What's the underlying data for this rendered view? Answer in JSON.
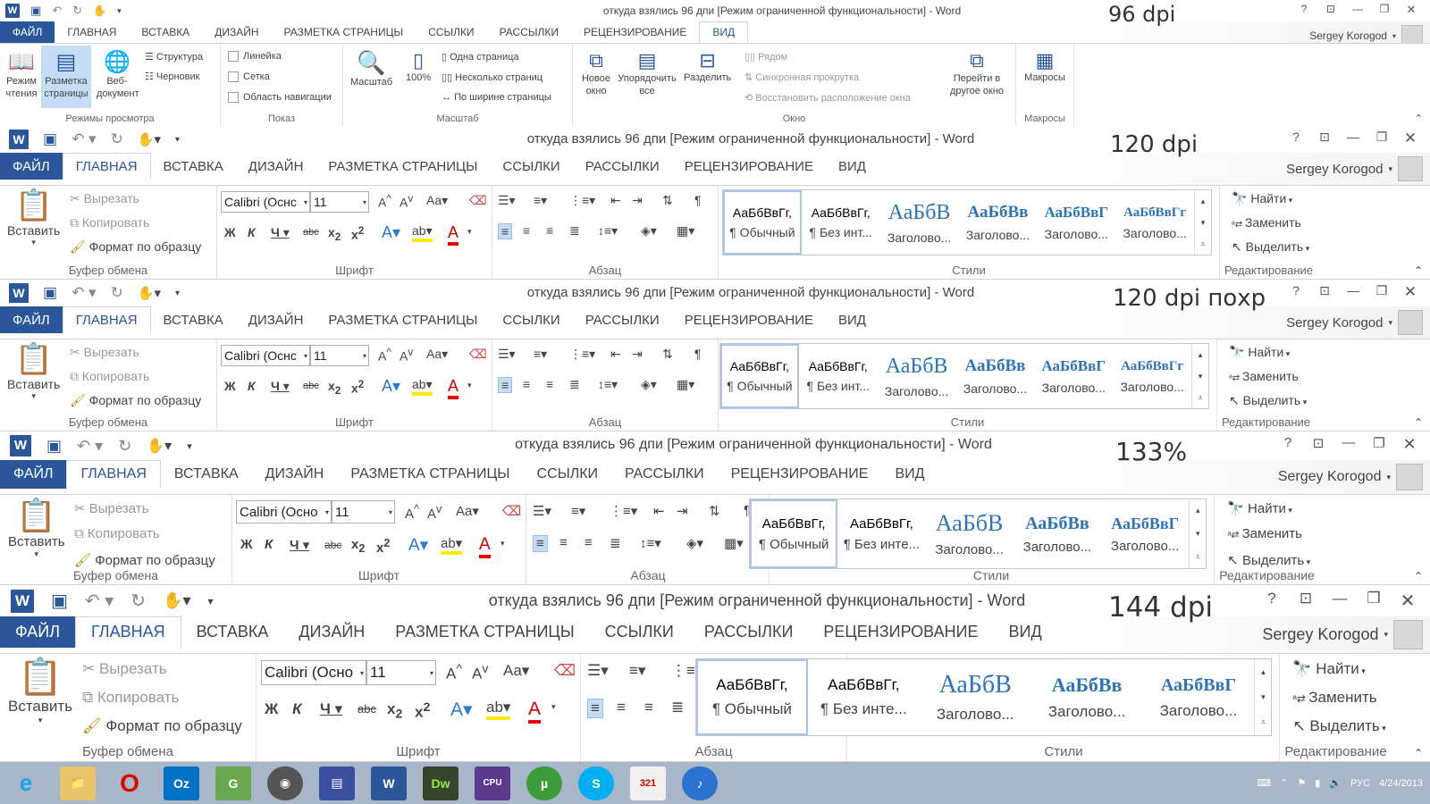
{
  "bands": [
    {
      "dpi": "96 dpi",
      "title": "откуда взялись 96 дпи [Режим ограниченной функциональности] - Word",
      "tabs": [
        "ФАЙЛ",
        "ГЛАВНАЯ",
        "ВСТАВКА",
        "ДИЗАЙН",
        "РАЗМЕТКА СТРАНИЦЫ",
        "ССЫЛКИ",
        "РАССЫЛКИ",
        "РЕЦЕНЗИРОВАНИЕ",
        "ВИД"
      ],
      "active_tab": "ВИД",
      "user": "Sergey Korogod",
      "view_ribbon": {
        "modes": {
          "read": "Режим чтения",
          "print": "Разметка страницы",
          "web": "Веб-документ",
          "outline": "Структура",
          "draft": "Черновик",
          "label": "Режимы просмотра"
        },
        "show": {
          "ruler": "Линейка",
          "grid": "Сетка",
          "nav": "Область навигации",
          "label": "Показ"
        },
        "zoom": {
          "zoom": "Масштаб",
          "pct": "100%",
          "one": "Одна страница",
          "multi": "Несколько страниц",
          "width": "По ширине страницы",
          "label": "Масштаб"
        },
        "window": {
          "new": "Новое окно",
          "arrange": "Упорядочить все",
          "split": "Разделить",
          "side": "Рядом",
          "sync": "Синхронная прокрутка",
          "reset": "Восстановить расположение окна",
          "switch": "Перейти в другое окно",
          "label": "Окно"
        },
        "macros": {
          "btn": "Макросы",
          "label": "Макросы"
        }
      }
    },
    {
      "dpi": "120 dpi",
      "title": "откуда взялись 96 дпи [Режим ограниченной функциональности] - Word",
      "tabs": [
        "ФАЙЛ",
        "ГЛАВНАЯ",
        "ВСТАВКА",
        "ДИЗАЙН",
        "РАЗМЕТКА СТРАНИЦЫ",
        "ССЫЛКИ",
        "РАССЫЛКИ",
        "РЕЦЕНЗИРОВАНИЕ",
        "ВИД"
      ],
      "user": "Sergey Korogod"
    },
    {
      "dpi": "120 dpi похр",
      "title": "откуда взялись 96 дпи [Режим ограниченной функциональности] - Word",
      "tabs": [
        "ФАЙЛ",
        "ГЛАВНАЯ",
        "ВСТАВКА",
        "ДИЗАЙН",
        "РАЗМЕТКА СТРАНИЦЫ",
        "ССЫЛКИ",
        "РАССЫЛКИ",
        "РЕЦЕНЗИРОВАНИЕ",
        "ВИД"
      ],
      "user": "Sergey Korogod"
    },
    {
      "dpi": "133%",
      "title": "откуда взялись 96 дпи [Режим ограниченной функциональности] - Word",
      "tabs": [
        "ФАЙЛ",
        "ГЛАВНАЯ",
        "ВСТАВКА",
        "ДИЗАЙН",
        "РАЗМЕТКА СТРАНИЦЫ",
        "ССЫЛКИ",
        "РАССЫЛКИ",
        "РЕЦЕНЗИРОВАНИЕ",
        "ВИД"
      ],
      "user": "Sergey Korogod"
    },
    {
      "dpi": "144 dpi",
      "title": "откуда взялись 96 дпи [Режим ограниченной функциональности] - Word",
      "tabs": [
        "ФАЙЛ",
        "ГЛАВНАЯ",
        "ВСТАВКА",
        "ДИЗАЙН",
        "РАЗМЕТКА СТРАНИЦЫ",
        "ССЫЛКИ",
        "РАССЫЛКИ",
        "РЕЦЕНЗИРОВАНИЕ",
        "ВИД"
      ],
      "user": "Sergey Korogod"
    }
  ],
  "home": {
    "paste": "Вставить",
    "cut": "Вырезать",
    "copy": "Копировать",
    "painter": "Формат по образцу",
    "clipboard_label": "Буфер обмена",
    "font_name": "Calibri (Оснс",
    "font_name_b": "Calibri (Осно",
    "font_size": "11",
    "font_label": "Шрифт",
    "paragraph_label": "Абзац",
    "styles_label": "Стили",
    "editing_label": "Редактирование",
    "find": "Найти",
    "replace": "Заменить",
    "select": "Выделить",
    "styles": {
      "normal_preview": "АаБбВвГг,",
      "normal": "¶ Обычный",
      "nospace_preview": "АаБбВвГг,",
      "nospace": "¶ Без инт...",
      "nospace_long": "¶ Без инте...",
      "h1_preview": "АаБбВ",
      "h2_preview": "АаБбВв",
      "h3_preview": "АаБбВвГ",
      "h4_preview": "АаБбВвГг",
      "heading": "Заголово..."
    }
  },
  "taskbar": {
    "lang": "РУС",
    "date": "4/24/2013",
    "apps": [
      "e",
      "📁",
      "O",
      "Oz",
      "G",
      "◉",
      "▤",
      "W",
      "Dw",
      "CPU",
      "µ",
      "S",
      "321",
      "♪"
    ]
  },
  "colors": {
    "accent": "#2b579a",
    "heading": "#2e74b5"
  }
}
